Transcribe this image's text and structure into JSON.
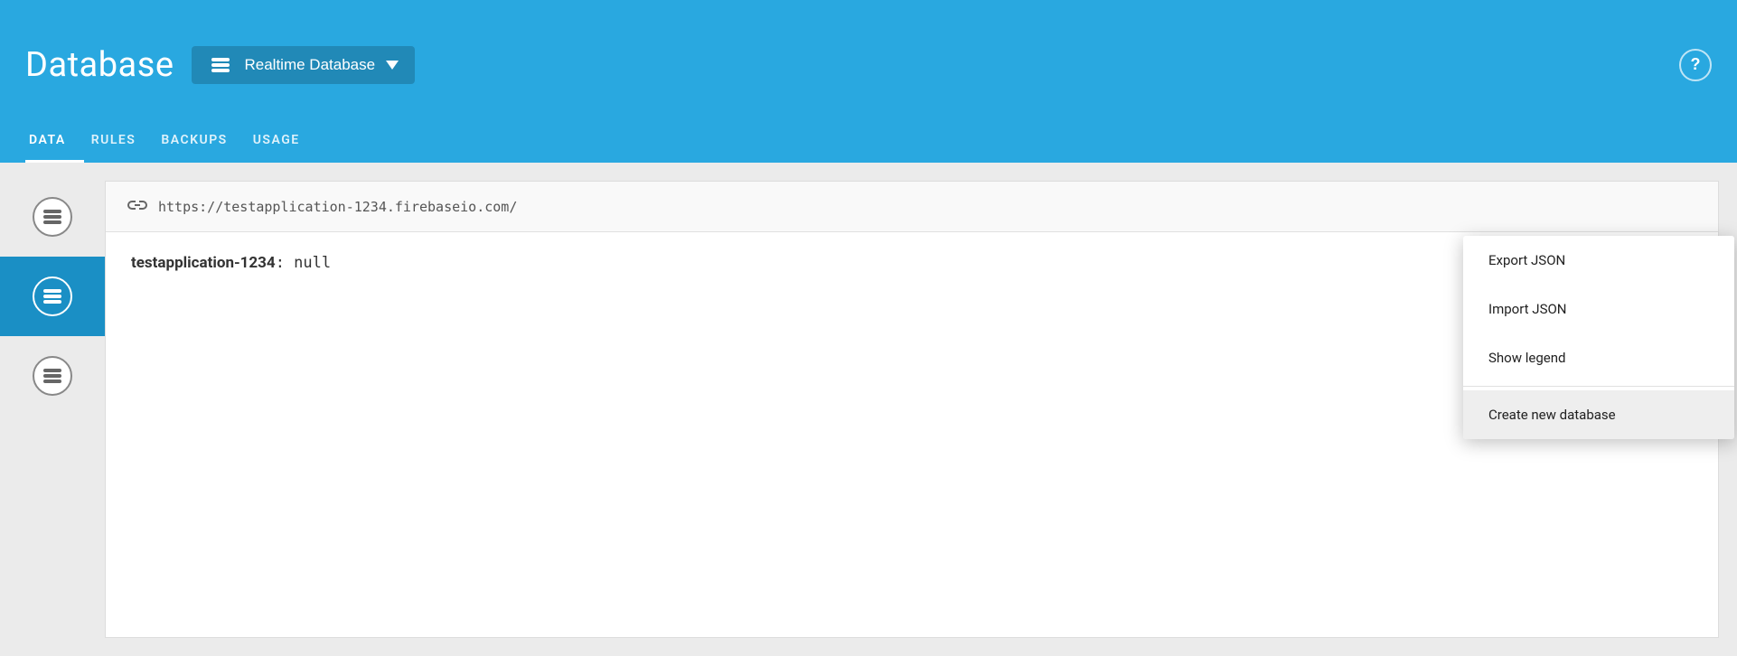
{
  "header": {
    "title": "Database",
    "db_selector": {
      "label": "Realtime Database"
    },
    "help_label": "?"
  },
  "tabs": [
    {
      "id": "data",
      "label": "DATA",
      "active": true
    },
    {
      "id": "rules",
      "label": "RULES",
      "active": false
    },
    {
      "id": "backups",
      "label": "BACKUPS",
      "active": false
    },
    {
      "id": "usage",
      "label": "USAGE",
      "active": false
    }
  ],
  "url_bar": {
    "url": "https://testapplication-1234.firebaseio.com/"
  },
  "data_content": {
    "key": "testapplication-1234",
    "separator": ": ",
    "value": "null"
  },
  "dropdown": {
    "items": [
      {
        "id": "export-json",
        "label": "Export JSON",
        "highlighted": false
      },
      {
        "id": "import-json",
        "label": "Import JSON",
        "highlighted": false
      },
      {
        "id": "show-legend",
        "label": "Show legend",
        "highlighted": false
      },
      {
        "id": "create-new-database",
        "label": "Create new database",
        "highlighted": true
      }
    ]
  },
  "sidebar": {
    "items": [
      {
        "id": "db-1",
        "active": false
      },
      {
        "id": "db-2",
        "active": true
      },
      {
        "id": "db-3",
        "active": false
      }
    ]
  }
}
